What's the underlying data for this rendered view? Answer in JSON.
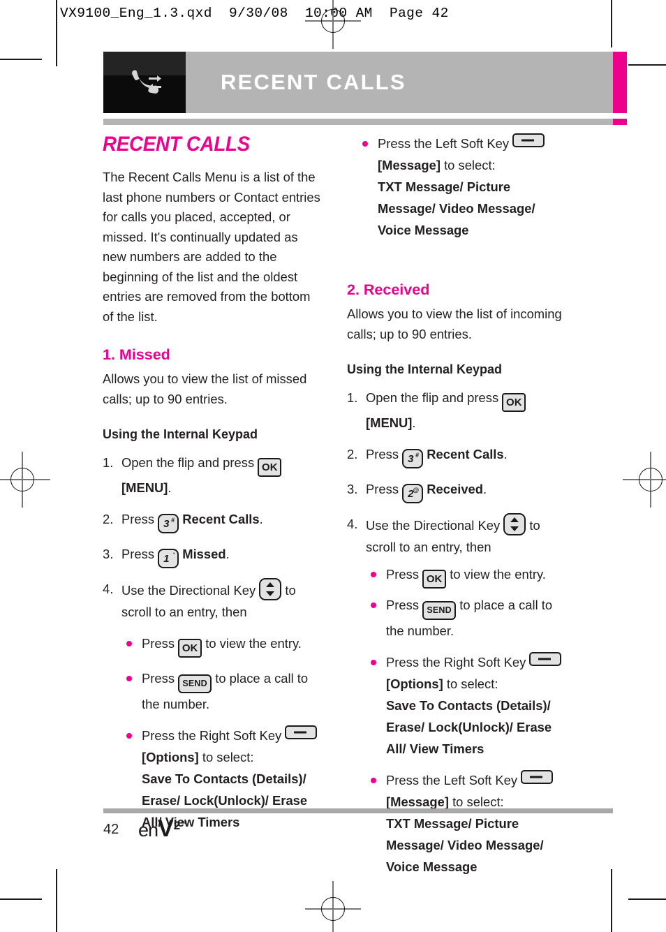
{
  "proof_header": "VX9100_Eng_1.3.qxd  9/30/08  10:00 AM  Page 42",
  "colors": {
    "magenta": "#ec008c",
    "band_gray": "#b4b4b4",
    "text": "#231f20",
    "icon_box": "#0b0b0b"
  },
  "header": {
    "chapter_title": "RECENT CALLS",
    "icon_name": "recent-calls-phone-icon"
  },
  "footer": {
    "page_number": "42",
    "logo_en": "en",
    "logo_v": "V",
    "logo_superscript": "2",
    "logo_tm": "™"
  },
  "left_column": {
    "doc_title": "RECENT CALLS",
    "intro": "The Recent Calls Menu is a list of the last phone numbers or Contact entries for calls you placed, accepted, or missed. It's continually updated as new numbers are added to the beginning of the list and the oldest entries are removed from the bottom of the list.",
    "section_title": "1. Missed",
    "section_desc": "Allows you to view the list of missed calls; up to 90 entries.",
    "subhead": "Using the Internal Keypad",
    "steps": [
      {
        "num": "1.",
        "pre": "Open the flip and press ",
        "key": "OK",
        "key_name": "ok-key-icon",
        "post_bold": "[MENU]",
        "post": "."
      },
      {
        "num": "2.",
        "pre": "Press ",
        "key_digit": "3",
        "key_sup": "#",
        "key_name": "keypad-3-key-icon",
        "post_bold": "Recent Calls",
        "post": "."
      },
      {
        "num": "3.",
        "pre": "Press ",
        "key_digit": "1",
        "key_sup": "'",
        "key_name": "keypad-1-key-icon",
        "post_bold": "Missed",
        "post": "."
      },
      {
        "num": "4.",
        "pre": "Use the Directional Key ",
        "key_name": "directional-key-icon",
        "post": " to scroll to an entry, then"
      }
    ],
    "bullets": [
      {
        "pre": "Press ",
        "key": "OK",
        "key_name": "ok-key-icon",
        "post": " to view the entry."
      },
      {
        "pre": "Press ",
        "key": "SEND",
        "key_name": "send-key-icon",
        "post": " to place a call to the number."
      },
      {
        "pre": "Press the Right Soft Key ",
        "key_name": "soft-key-icon",
        "bold_label": "[Options]",
        "mid": " to select:",
        "options": "Save To Contacts (Details)/ Erase/ Lock(Unlock)/ Erase All/ View Timers"
      }
    ]
  },
  "right_column": {
    "top_bullet": {
      "pre": "Press the Left Soft Key ",
      "key_name": "soft-key-icon",
      "bold_label": "[Message]",
      "mid": " to select:",
      "options": "TXT Message/ Picture Message/ Video Message/ Voice Message"
    },
    "section_title": "2. Received",
    "section_desc": "Allows you to view the list of incoming calls; up to 90 entries.",
    "subhead": "Using the Internal Keypad",
    "steps": [
      {
        "num": "1.",
        "pre": "Open the flip and press ",
        "key": "OK",
        "key_name": "ok-key-icon",
        "post_bold": "[MENU]",
        "post": "."
      },
      {
        "num": "2.",
        "pre": "Press ",
        "key_digit": "3",
        "key_sup": "#",
        "key_name": "keypad-3-key-icon",
        "post_bold": "Recent Calls",
        "post": "."
      },
      {
        "num": "3.",
        "pre": "Press ",
        "key_digit": "2",
        "key_sup": "@",
        "key_name": "keypad-2-key-icon",
        "post_bold": "Received",
        "post": "."
      },
      {
        "num": "4.",
        "pre": "Use the Directional Key ",
        "key_name": "directional-key-icon",
        "post": " to scroll to an entry, then"
      }
    ],
    "bullets": [
      {
        "pre": "Press ",
        "key": "OK",
        "key_name": "ok-key-icon",
        "post": " to view the entry."
      },
      {
        "pre": "Press ",
        "key": "SEND",
        "key_name": "send-key-icon",
        "post": " to place a call to the number."
      },
      {
        "pre": "Press the Right Soft Key ",
        "key_name": "soft-key-icon",
        "bold_label": "[Options]",
        "mid": " to select:",
        "options": "Save To Contacts (Details)/ Erase/ Lock(Unlock)/ Erase All/ View Timers"
      },
      {
        "pre": "Press the Left Soft Key ",
        "key_name": "soft-key-icon",
        "bold_label": "[Message]",
        "mid": " to select:",
        "options": "TXT Message/ Picture Message/ Video Message/ Voice Message"
      }
    ]
  }
}
